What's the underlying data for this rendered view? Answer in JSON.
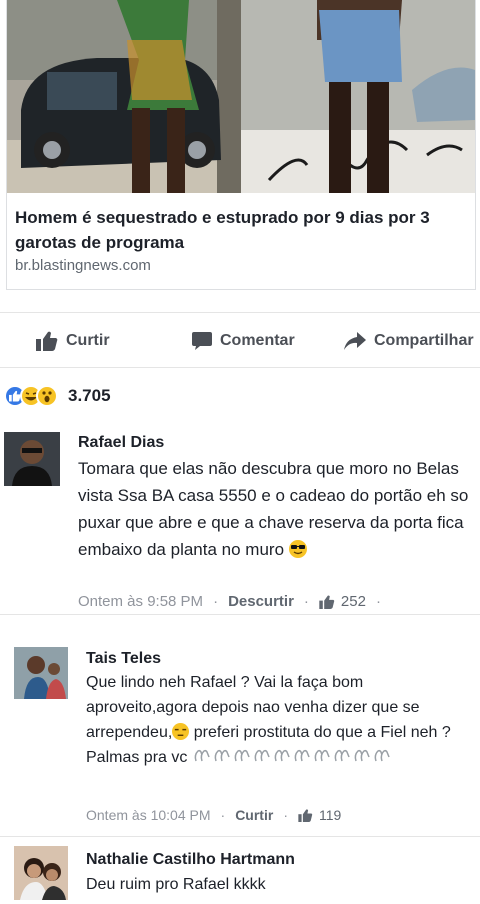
{
  "post": {
    "link_title": "Homem é sequestrado e estuprado por 9 dias por 3 garotas de programa",
    "link_domain": "br.blastingnews.com"
  },
  "actions": {
    "like": "Curtir",
    "comment": "Comentar",
    "share": "Compartilhar"
  },
  "reactions": {
    "icons": [
      "like-icon",
      "haha-icon",
      "wow-icon"
    ],
    "count": "3.705"
  },
  "comments": [
    {
      "name": "Rafael Dias",
      "text": "Tomara que elas não descubra que moro no Belas vista Ssa BA casa 5550 e o cadeao do portão eh so puxar que abre e que a chave reserva da porta fica embaixo da planta no muro",
      "emoji": "sunglasses-emoji",
      "time": "Ontem às 9:58 PM",
      "action": "Descurtir",
      "likes": "252"
    },
    {
      "name": "Tais Teles",
      "text_part1": "Que lindo neh Rafael  ? Vai la faça bom aproveito,agora depois nao venha dizer que se arrependeu,",
      "emoji": "unamused-emoji",
      "text_part2": " preferi prostituta do que a Fiel neh ? Palmas pra vc",
      "clap_count": 10,
      "time": "Ontem às 10:04 PM",
      "action": "Curtir",
      "likes": "119"
    },
    {
      "name": "Nathalie Castilho Hartmann",
      "text": "Deu ruim pro Rafael kkkk"
    }
  ],
  "colors": {
    "like_blue": "#3578e5",
    "text": "#1d2129",
    "meta": "#90949c",
    "emoji_yellow": "#f7c325"
  }
}
